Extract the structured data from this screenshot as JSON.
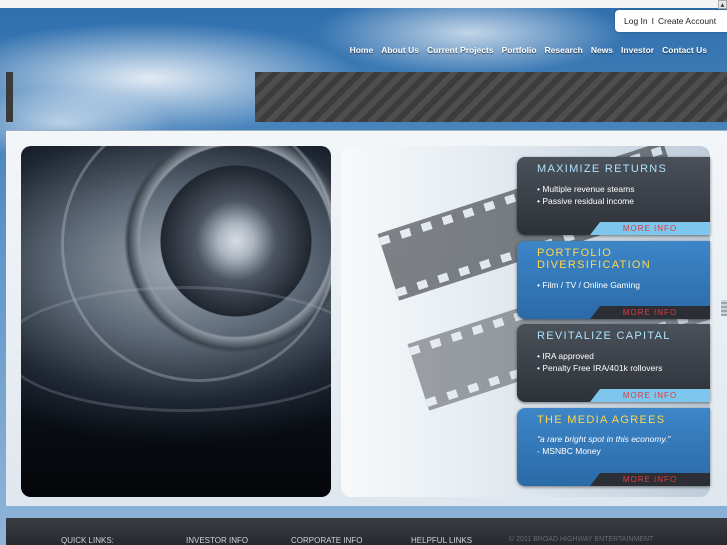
{
  "header": {
    "login_label": "Log In",
    "separator": "I",
    "create_account_label": "Create Account",
    "scroll_arrow": "▲"
  },
  "nav": {
    "items": [
      {
        "label": "Home"
      },
      {
        "label": "About Us"
      },
      {
        "label": "Current Projects"
      },
      {
        "label": "Portfolio"
      },
      {
        "label": "Research"
      },
      {
        "label": "News"
      },
      {
        "label": "Investor"
      },
      {
        "label": "Contact Us"
      }
    ]
  },
  "promos": [
    {
      "title": "MAXIMIZE RETURNS",
      "title_color": "#aee0ff",
      "lines": [
        "• Multiple revenue steams",
        "• Passive residual income"
      ],
      "button": "MORE INFO"
    },
    {
      "title_line1": "PORTFOLIO",
      "title_line2": "DIVERSIFICATION",
      "title_color": "#ffd64a",
      "lines": [
        "• Film / TV / Online Gaming"
      ],
      "button": "MORE INFO"
    },
    {
      "title": "REVITALIZE CAPITAL",
      "title_color": "#aee0ff",
      "lines": [
        "• IRA approved",
        "• Penalty Free IRA/401k rollovers"
      ],
      "button": "MORE INFO"
    },
    {
      "title": "THE MEDIA AGREES",
      "title_color": "#ffd64a",
      "quote": "\"a rare bright spot in this economy.\"",
      "source": "- MSNBC Money",
      "button": "MORE INFO"
    }
  ],
  "footer": {
    "quick_links": "QUICK LINKS:",
    "investor_info": "INVESTOR INFO",
    "corporate_info": "CORPORATE INFO",
    "helpful_links": "HELPFUL LINKS",
    "copyright": "© 2011 BROAD HIGHWAY ENTERTAINMENT"
  }
}
